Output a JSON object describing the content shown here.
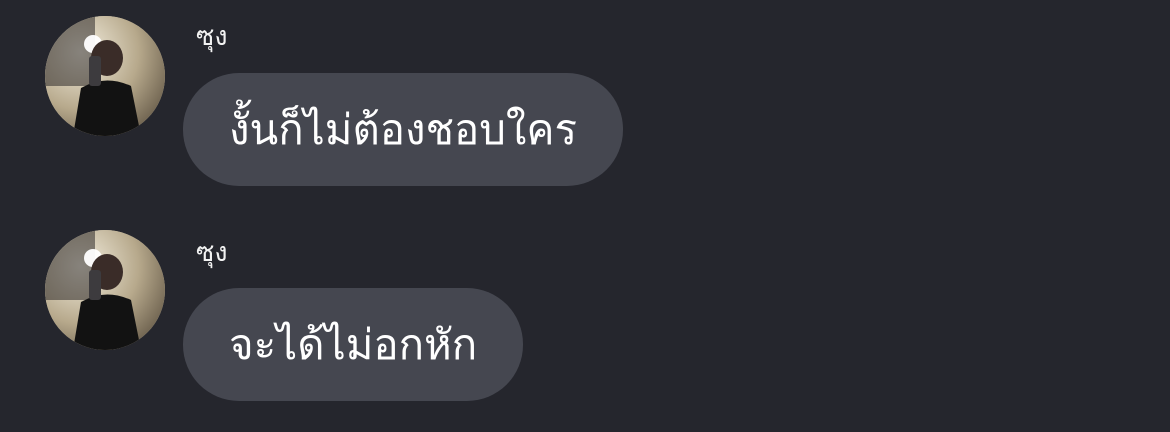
{
  "colors": {
    "background": "#25262d",
    "bubble": "#454750",
    "text": "#ffffff"
  },
  "messages": [
    {
      "sender": "ซุง",
      "text": "งั้นก็ไม่ต้องชอบใคร",
      "avatar_icon": "profile-photo"
    },
    {
      "sender": "ซุง",
      "text": "จะได้ไม่อกหัก",
      "avatar_icon": "profile-photo"
    }
  ]
}
